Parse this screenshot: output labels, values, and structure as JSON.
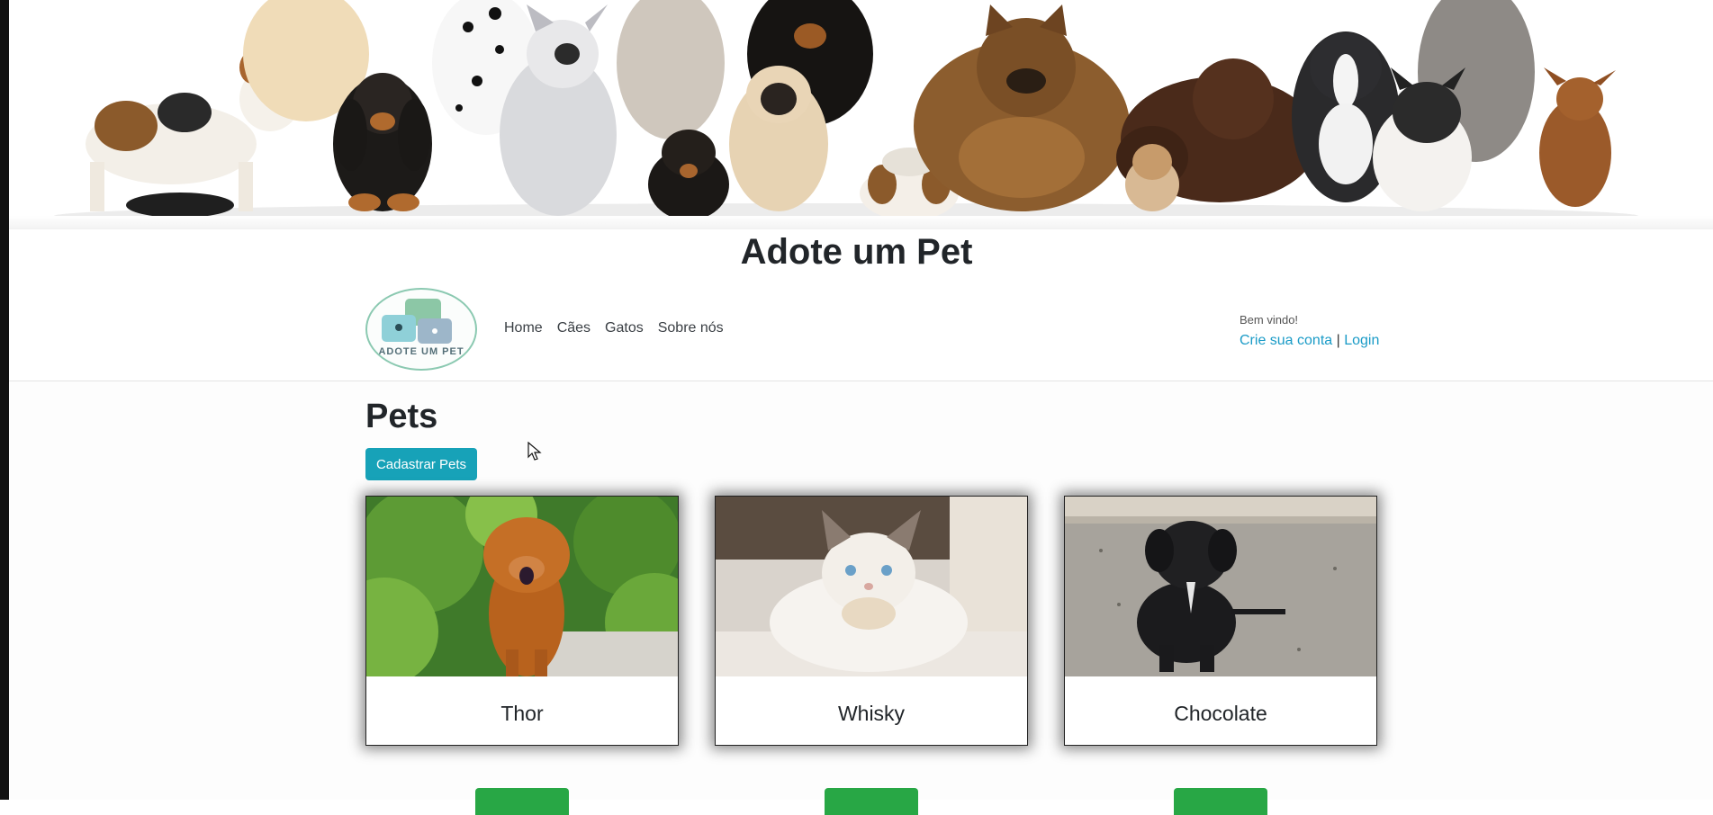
{
  "site": {
    "title": "Adote um Pet"
  },
  "nav": {
    "links": [
      {
        "label": "Home"
      },
      {
        "label": "Cães"
      },
      {
        "label": "Gatos"
      },
      {
        "label": "Sobre nós"
      }
    ]
  },
  "account": {
    "welcome": "Bem vindo!",
    "create_label": "Crie sua conta",
    "separator": "|",
    "login_label": "Login"
  },
  "main": {
    "heading": "Pets",
    "register_button": "Cadastrar Pets",
    "pets": [
      {
        "name": "Thor"
      },
      {
        "name": "Whisky"
      },
      {
        "name": "Chocolate"
      }
    ]
  },
  "colors": {
    "primary_button": "#17a2b8",
    "adopt_button": "#28a745",
    "link": "#1a9bc7"
  },
  "icons": {
    "logo": "pet-logo-icon",
    "cursor": "mouse-cursor-icon"
  }
}
